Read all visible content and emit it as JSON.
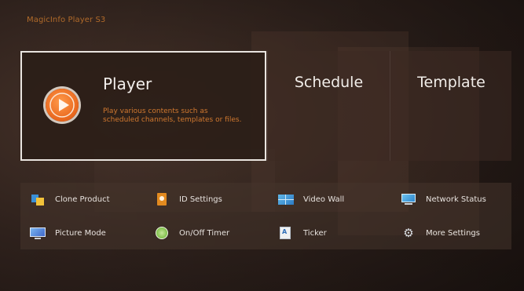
{
  "app": {
    "title": "MagicInfo Player S3"
  },
  "cards": {
    "player": {
      "title": "Player",
      "description": "Play various contents such as scheduled channels, templates or files.",
      "icon": "play-icon",
      "selected": true
    },
    "schedule": {
      "title": "Schedule"
    },
    "template": {
      "title": "Template"
    }
  },
  "menu": {
    "items": [
      {
        "label": "Clone Product",
        "icon": "clone-product-icon"
      },
      {
        "label": "ID Settings",
        "icon": "id-settings-icon"
      },
      {
        "label": "Video Wall",
        "icon": "video-wall-icon"
      },
      {
        "label": "Network Status",
        "icon": "network-status-icon"
      },
      {
        "label": "Picture Mode",
        "icon": "picture-mode-icon"
      },
      {
        "label": "On/Off Timer",
        "icon": "timer-icon"
      },
      {
        "label": "Ticker",
        "icon": "ticker-icon",
        "glyph": "A"
      },
      {
        "label": "More Settings",
        "icon": "gear-icon",
        "glyph": "⚙"
      }
    ]
  },
  "colors": {
    "accent": "#e8651c",
    "description_text": "#d0782f",
    "app_title": "#b06a2a",
    "background": "#2a1d19"
  }
}
